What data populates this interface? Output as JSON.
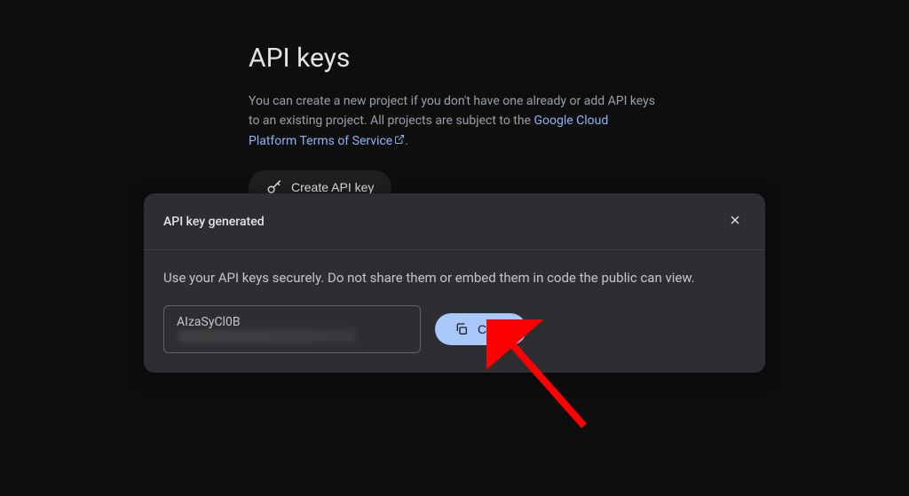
{
  "page": {
    "title": "API keys",
    "description_pre": "You can create a new project if you don't have one already or add API keys to an existing project. All projects are subject to the ",
    "description_link": "Google Cloud Platform Terms of Service",
    "description_post": ".",
    "create_button_label": "Create API key"
  },
  "dialog": {
    "title": "API key generated",
    "message": "Use your API keys securely. Do not share them or embed them in code the public can view.",
    "api_key_visible": "AIzaSyCl0B",
    "copy_label": "Copy"
  },
  "colors": {
    "background": "#0e0e0f",
    "dialog_bg": "#2d2e31",
    "link": "#8ab4f8",
    "copy_btn": "#a8c7fa"
  }
}
